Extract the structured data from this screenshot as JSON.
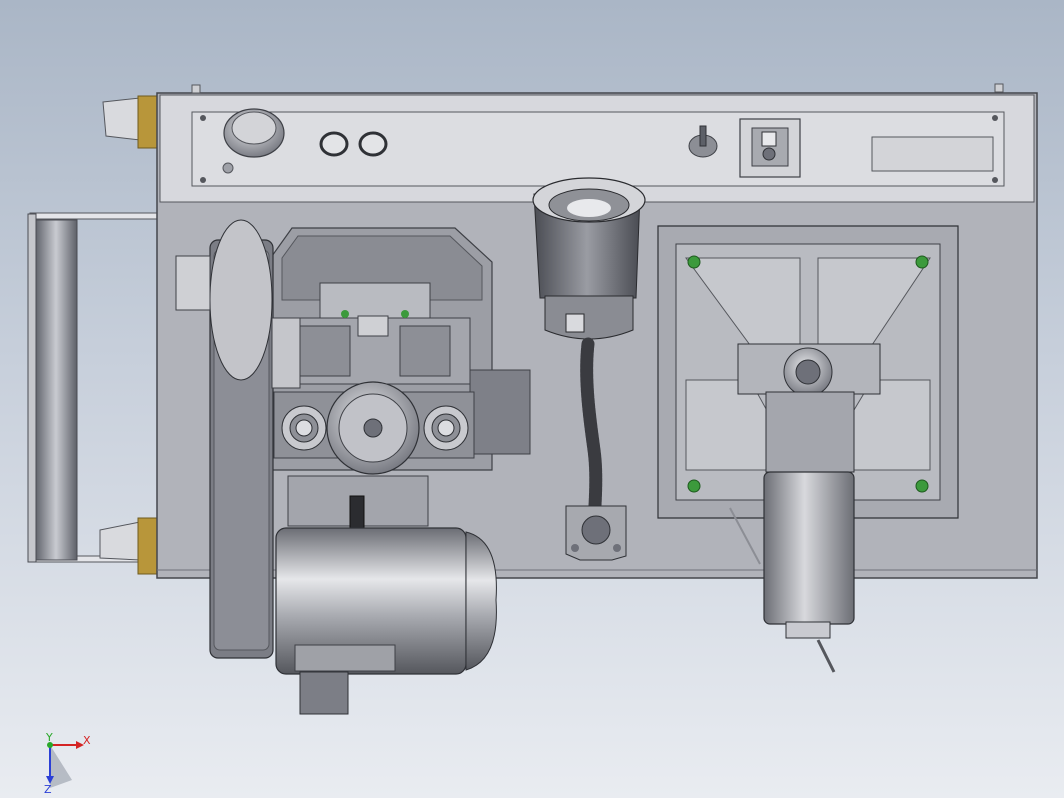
{
  "viewport": {
    "background_top": "#aab6c6",
    "background_bottom": "#e9ecf1"
  },
  "model": {
    "body_color": "#b1b3ba",
    "panel_color": "#d7d8dd",
    "dark_metal": "#6e7079",
    "fastener_color": "#3c9a3c",
    "brass_color": "#b8963a"
  },
  "triad": {
    "x_label": "X",
    "y_label": "Y",
    "z_label": "Z",
    "x_color": "#d42424",
    "y_color": "#2aa82a",
    "z_color": "#2b3fd6"
  }
}
